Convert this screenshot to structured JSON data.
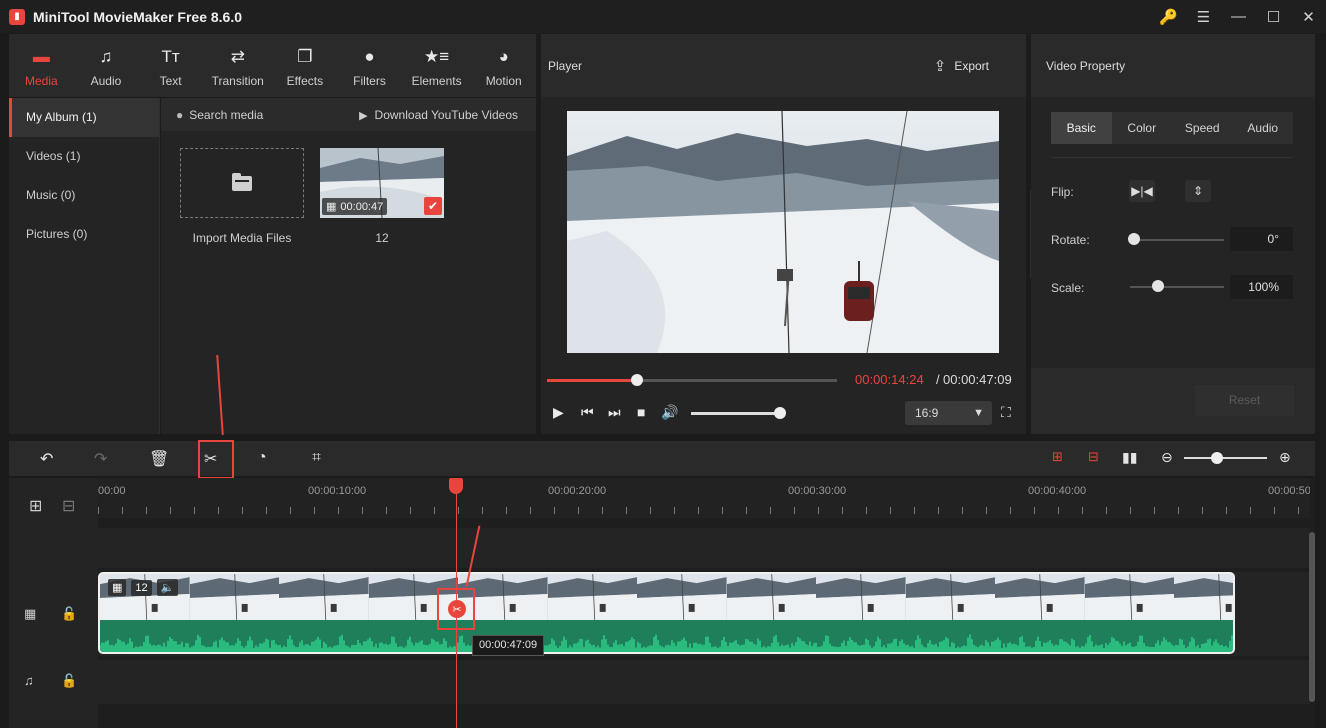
{
  "window": {
    "title": "MiniTool MovieMaker Free 8.6.0",
    "controls": [
      "upgrade-key-icon",
      "menu-icon",
      "minimize-icon",
      "maximize-icon",
      "close-icon"
    ]
  },
  "main_tabs": [
    {
      "label": "Media",
      "icon": "media-icon",
      "active": true
    },
    {
      "label": "Audio",
      "icon": "music-note-icon"
    },
    {
      "label": "Text",
      "icon": "text-icon"
    },
    {
      "label": "Transition",
      "icon": "transition-icon"
    },
    {
      "label": "Effects",
      "icon": "effects-icon"
    },
    {
      "label": "Filters",
      "icon": "filters-icon"
    },
    {
      "label": "Elements",
      "icon": "elements-icon"
    },
    {
      "label": "Motion",
      "icon": "motion-icon"
    }
  ],
  "album": {
    "items": [
      {
        "label": "My Album (1)",
        "active": true
      },
      {
        "label": "Videos (1)"
      },
      {
        "label": "Music (0)"
      },
      {
        "label": "Pictures (0)"
      }
    ]
  },
  "media": {
    "search_label": "Search media",
    "download_label": "Download YouTube Videos",
    "import_label": "Import Media Files",
    "clip_name": "12",
    "clip_duration": "00:00:47"
  },
  "player": {
    "title": "Player",
    "export_label": "Export",
    "current_time": "00:00:14:24",
    "separator": "/",
    "total_time": "00:00:47:09",
    "progress": 0.31,
    "volume": 0.95,
    "aspect_ratio": "16:9"
  },
  "property": {
    "title": "Video Property",
    "tabs": [
      {
        "label": "Basic",
        "active": true
      },
      {
        "label": "Color"
      },
      {
        "label": "Speed"
      },
      {
        "label": "Audio"
      }
    ],
    "flip_label": "Flip:",
    "rotate_label": "Rotate:",
    "rotate_value": "0°",
    "rotate_level": 0.0,
    "scale_label": "Scale:",
    "scale_value": "100%",
    "scale_level": 0.3,
    "reset_label": "Reset"
  },
  "toolbar": {
    "tools": [
      "undo-icon",
      "redo-icon",
      "delete-icon",
      "split-icon",
      "speed-icon",
      "crop-icon"
    ],
    "right_tools": [
      "fit-timeline-icon",
      "split-audio-icon",
      "zoom-fit-icon",
      "zoom-out-icon",
      "zoom-in-icon"
    ],
    "zoom_level": 0.4
  },
  "timeline": {
    "ticks": [
      "00:00",
      "00:00:10:00",
      "00:00:20:00",
      "00:00:30:00",
      "00:00:40:00",
      "00:00:50"
    ],
    "clip_label": "12",
    "tooltip": "00:00:47:09"
  },
  "colors": {
    "accent": "#e8453c",
    "waveform": "#1f7f5a",
    "background": "#1b1b1b"
  }
}
